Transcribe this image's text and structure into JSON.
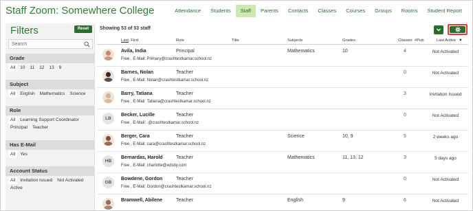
{
  "app": {
    "title": "Staff Zoom: Somewhere College"
  },
  "nav": [
    {
      "label": "Attendance",
      "active": false
    },
    {
      "label": "Students",
      "active": false
    },
    {
      "label": "Staff",
      "active": true
    },
    {
      "label": "Parents",
      "active": false
    },
    {
      "label": "Contacts",
      "active": false
    },
    {
      "label": "Classes",
      "active": false
    },
    {
      "label": "Courses",
      "active": false
    },
    {
      "label": "Groups",
      "active": false
    },
    {
      "label": "Rooms",
      "active": false
    },
    {
      "label": "Student Report",
      "active": false
    }
  ],
  "sidebar": {
    "title": "Filters",
    "reset_label": "Reset",
    "search_placeholder": "Search",
    "sections": [
      {
        "title": "Grade",
        "options": [
          "All",
          "10",
          "11",
          "12",
          "13",
          "9"
        ]
      },
      {
        "title": "Subject",
        "options": [
          "All",
          "English",
          "Mathematics",
          "Science"
        ]
      },
      {
        "title": "Role",
        "options": [
          "All",
          "Learning Support Coordinator",
          "Principal",
          "Teacher"
        ]
      },
      {
        "title": "Has E-Mail",
        "options": [
          "All",
          "Yes"
        ]
      },
      {
        "title": "Account Status",
        "options": [
          "All",
          "Invitation Issued",
          "Not Activated",
          "Active"
        ]
      }
    ]
  },
  "main": {
    "showing": "Showing 53 of 53 staff",
    "columns": {
      "last": "Last",
      "first": "First",
      "role": "Role",
      "title": "Title",
      "subjects": "Subjects",
      "grades": "Grades",
      "classes": "Classes",
      "pub": "#Pub",
      "last_active": "Last Active",
      "sort_indicator": "▼"
    },
    "rows": [
      {
        "name": "Avila, India",
        "role": "Principal",
        "title": "",
        "subjects": "Mathematics",
        "grades": "10",
        "classes": "4",
        "pub": "",
        "last_active": "Not Activated",
        "sub": "Free  ,  E-Mail: Primary@crashtestkamar.school.nz",
        "initials": "",
        "photo_color": "#c9876a"
      },
      {
        "name": "Barnes, Nolan",
        "role": "Teacher",
        "title": "",
        "subjects": "",
        "grades": "",
        "classes": "0",
        "pub": "",
        "last_active": "Not Activated",
        "sub": "Free  ,  E-Mail: Nolan@crashtestkamar.school.nz",
        "initials": "",
        "photo_color": "#3a2a22"
      },
      {
        "name": "Barry, Tatiana",
        "role": "Teacher",
        "title": "",
        "subjects": "",
        "grades": "",
        "classes": "3",
        "pub": "",
        "last_active": "Invitation Issued",
        "sub": "Free  ,  E-Mail: Tatiana@crashtestkamar.school.nz",
        "initials": "",
        "photo_color": "#d9b08c"
      },
      {
        "name": "Becker, Lucille",
        "role": "Teacher",
        "title": "",
        "subjects": "",
        "grades": "",
        "classes": "0",
        "pub": "",
        "last_active": "Not Activated",
        "sub": "Free  ,  E-Mail:  .@crashtestkamar.school.nz",
        "initials": "LB",
        "photo_color": ""
      },
      {
        "name": "Berger, Cara",
        "role": "Teacher",
        "title": "",
        "subjects": "Science",
        "grades": "10, 9",
        "classes": "5",
        "pub": "",
        "last_active": "2 weeks ago",
        "sub": "Free  ,  E-Mail: cara@crashtestkamar.school.nz",
        "initials": "",
        "photo_color": "#8a4a36"
      },
      {
        "name": "Bernardas, Harold",
        "role": "Teacher",
        "title": "",
        "subjects": "Mathematics",
        "grades": "11, 13, 12",
        "classes": "3",
        "pub": "",
        "last_active": "5 days ago",
        "sub": "Free  ,  E-Mail: charlotte@edsby.com",
        "initials": "HB",
        "photo_color": ""
      },
      {
        "name": "Bowdene, Gordon",
        "role": "Teacher",
        "title": "",
        "subjects": "",
        "grades": "",
        "classes": "0",
        "pub": "",
        "last_active": "Not Activated",
        "sub": "Free  ,  E-Mail: Gordon@crashtestkamar.school.nz",
        "initials": "GB",
        "photo_color": ""
      },
      {
        "name": "Bramwell, Abilene",
        "role": "Teacher",
        "title": "",
        "subjects": "English",
        "grades": "9",
        "classes": "6",
        "pub": "",
        "last_active": "Not Activated",
        "sub": "",
        "initials": "",
        "photo_color": "#9b6a50"
      }
    ]
  },
  "colors": {
    "brand_green": "#2e7d32",
    "button_green": "#2e6b2f",
    "nav_active_bg": "#cfe8b0",
    "highlight_red": "#e53935"
  },
  "icons": {
    "search": "search-icon",
    "download": "download-icon",
    "settings": "gear-icon"
  }
}
